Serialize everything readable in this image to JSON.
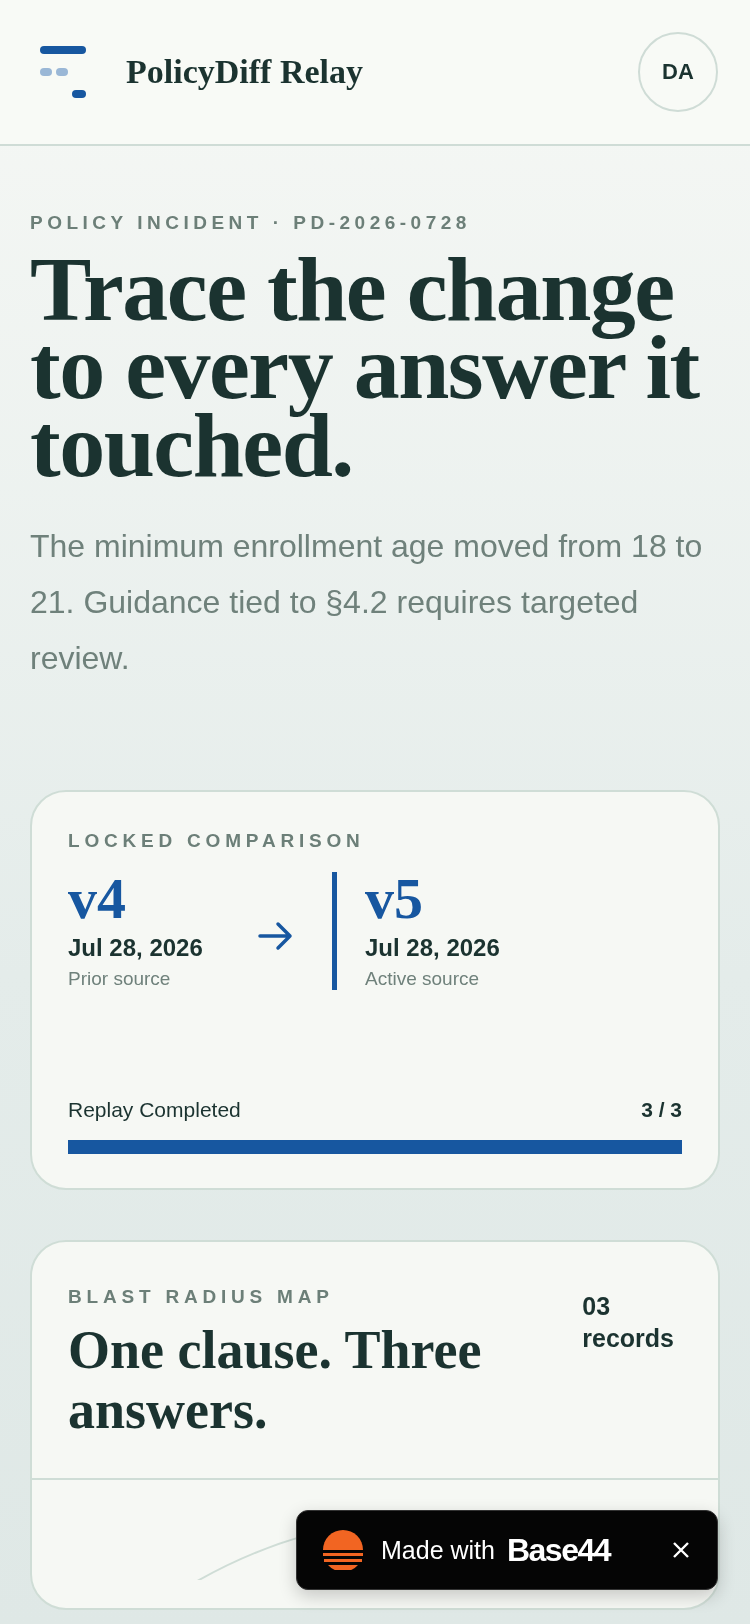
{
  "header": {
    "title": "PolicyDiff Relay",
    "avatar": "DA"
  },
  "hero": {
    "eyebrow": "POLICY INCIDENT · PD-2026-0728",
    "headline": "Trace the change to every answer it touched.",
    "summary": "The minimum enrollment age moved from 18 to 21. Guidance tied to §4.2 requires targeted review."
  },
  "comparison": {
    "label": "LOCKED COMPARISON",
    "versions": [
      {
        "version": "v4",
        "date": "Jul 28, 2026",
        "role": "Prior source"
      },
      {
        "version": "v5",
        "date": "Jul 28, 2026",
        "role": "Active source"
      }
    ],
    "progress": {
      "label": "Replay Completed",
      "count": "3 / 3",
      "level": 1
    }
  },
  "blast_map": {
    "label": "BLAST RADIUS MAP",
    "title": "One clause. Three answers.",
    "count": "03",
    "count_unit": "records"
  },
  "badge": {
    "text": "Made with",
    "brand": "Base44"
  }
}
